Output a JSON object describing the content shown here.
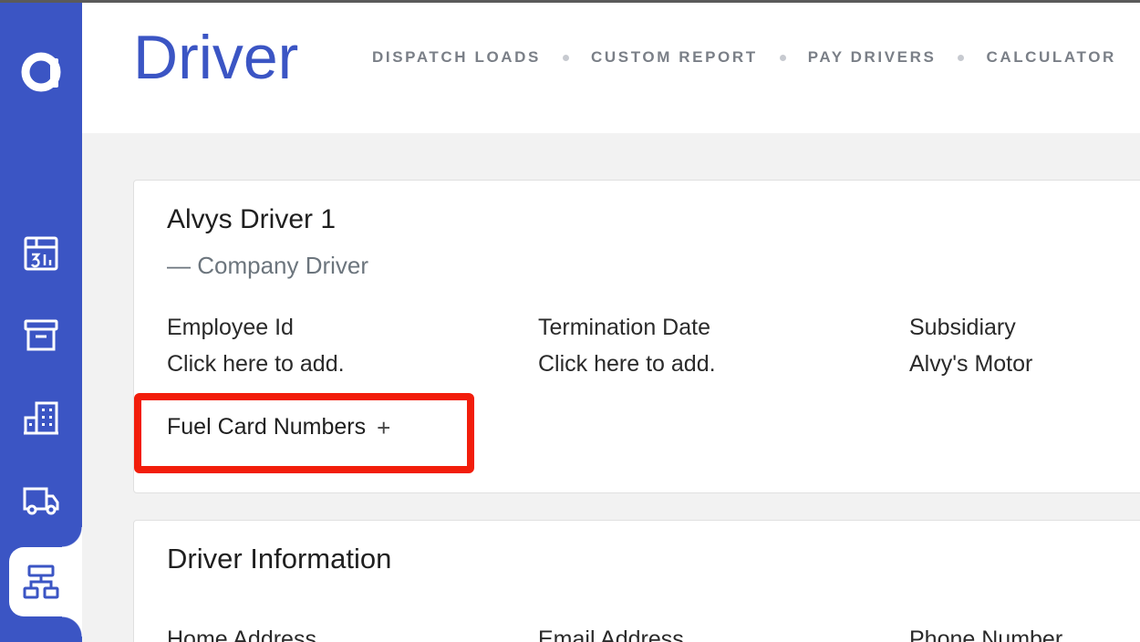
{
  "header": {
    "title": "Driver",
    "nav": [
      {
        "label": "DISPATCH LOADS"
      },
      {
        "label": "CUSTOM REPORT"
      },
      {
        "label": "PAY DRIVERS"
      },
      {
        "label": "CALCULATOR"
      }
    ]
  },
  "sidebar": {
    "logo_icon": "alvys-logo-icon",
    "items": [
      {
        "icon": "calendar-icon"
      },
      {
        "icon": "archive-icon"
      },
      {
        "icon": "building-icon"
      },
      {
        "icon": "truck-icon"
      },
      {
        "icon": "org-chart-icon",
        "active": true
      }
    ]
  },
  "driver_card": {
    "name": "Alvys Driver 1",
    "type": "— Company Driver",
    "fields": [
      {
        "label": "Employee Id",
        "value": "Click here to add."
      },
      {
        "label": "Termination Date",
        "value": "Click here to add."
      },
      {
        "label": "Subsidiary",
        "value": "Alvy's Motor"
      }
    ],
    "fuel_card_label": "Fuel Card Numbers",
    "fuel_card_add": "+"
  },
  "info_card": {
    "title": "Driver Information",
    "fields": [
      {
        "label": "Home Address"
      },
      {
        "label": "Email Address"
      },
      {
        "label": "Phone Number"
      }
    ]
  },
  "colors": {
    "brand": "#3b55c4",
    "highlight": "#f21d0b"
  }
}
